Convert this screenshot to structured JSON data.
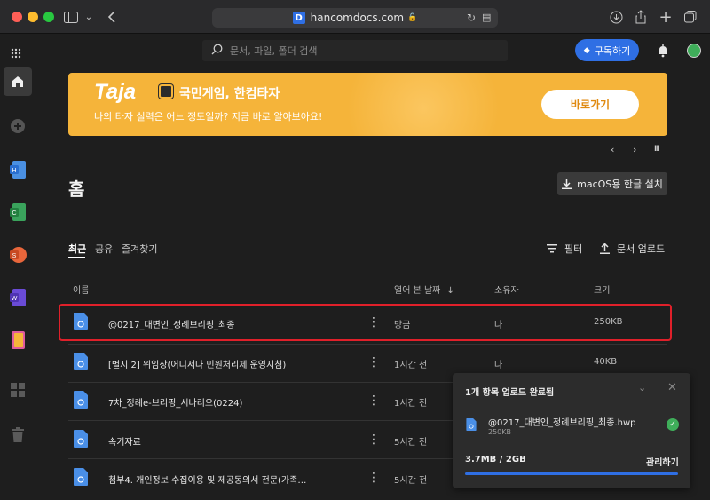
{
  "browser": {
    "url": "hancomdocs.com",
    "favicon_letter": "D"
  },
  "search": {
    "placeholder": "문서, 파일, 폴더 검색"
  },
  "header": {
    "subscribe_label": "구독하기"
  },
  "banner": {
    "brand": "Taja",
    "title": "국민게임, 한컴타자",
    "subtitle": "나의 타자 실력은 어느 정도일까? 지금 바로 알아보아요!",
    "button_label": "바로가기",
    "pause_symbol": "II"
  },
  "page": {
    "title": "홈",
    "mac_install_label": "macOS용 한글 설치"
  },
  "tabs": [
    {
      "label": "최근",
      "active": true
    },
    {
      "label": "공유",
      "active": false
    },
    {
      "label": "즐겨찾기",
      "active": false
    }
  ],
  "toolbar": {
    "filter_label": "필터",
    "upload_label": "문서 업로드"
  },
  "table": {
    "columns": {
      "name": "이름",
      "opened": "열어 본 날짜",
      "sort_arrow": "↓",
      "owner": "소유자",
      "size": "크기"
    },
    "rows": [
      {
        "name": "@0217_대변인_정례브리핑_최종",
        "opened": "방금",
        "owner": "나",
        "size": "250KB"
      },
      {
        "name": "[별지 2] 위임장(어디서나 민원처리제 운영지침)",
        "opened": "1시간 전",
        "owner": "나",
        "size": "40KB"
      },
      {
        "name": "7차_정례e-브리핑_시나리오(0224)",
        "opened": "1시간 전",
        "owner": "",
        "size": ""
      },
      {
        "name": "속기자료",
        "opened": "5시간 전",
        "owner": "",
        "size": ""
      },
      {
        "name": "첨부4. 개인정보 수집이용 및 제공동의서 전문(가족…",
        "opened": "5시간 전",
        "owner": "",
        "size": ""
      }
    ]
  },
  "upload_toast": {
    "title": "1개 항목 업로드 완료됨",
    "file_name": "@0217_대변인_정례브리핑_최종.hwp",
    "file_size": "250KB",
    "storage": "3.7MB / 2GB",
    "manage_label": "관리하기"
  }
}
